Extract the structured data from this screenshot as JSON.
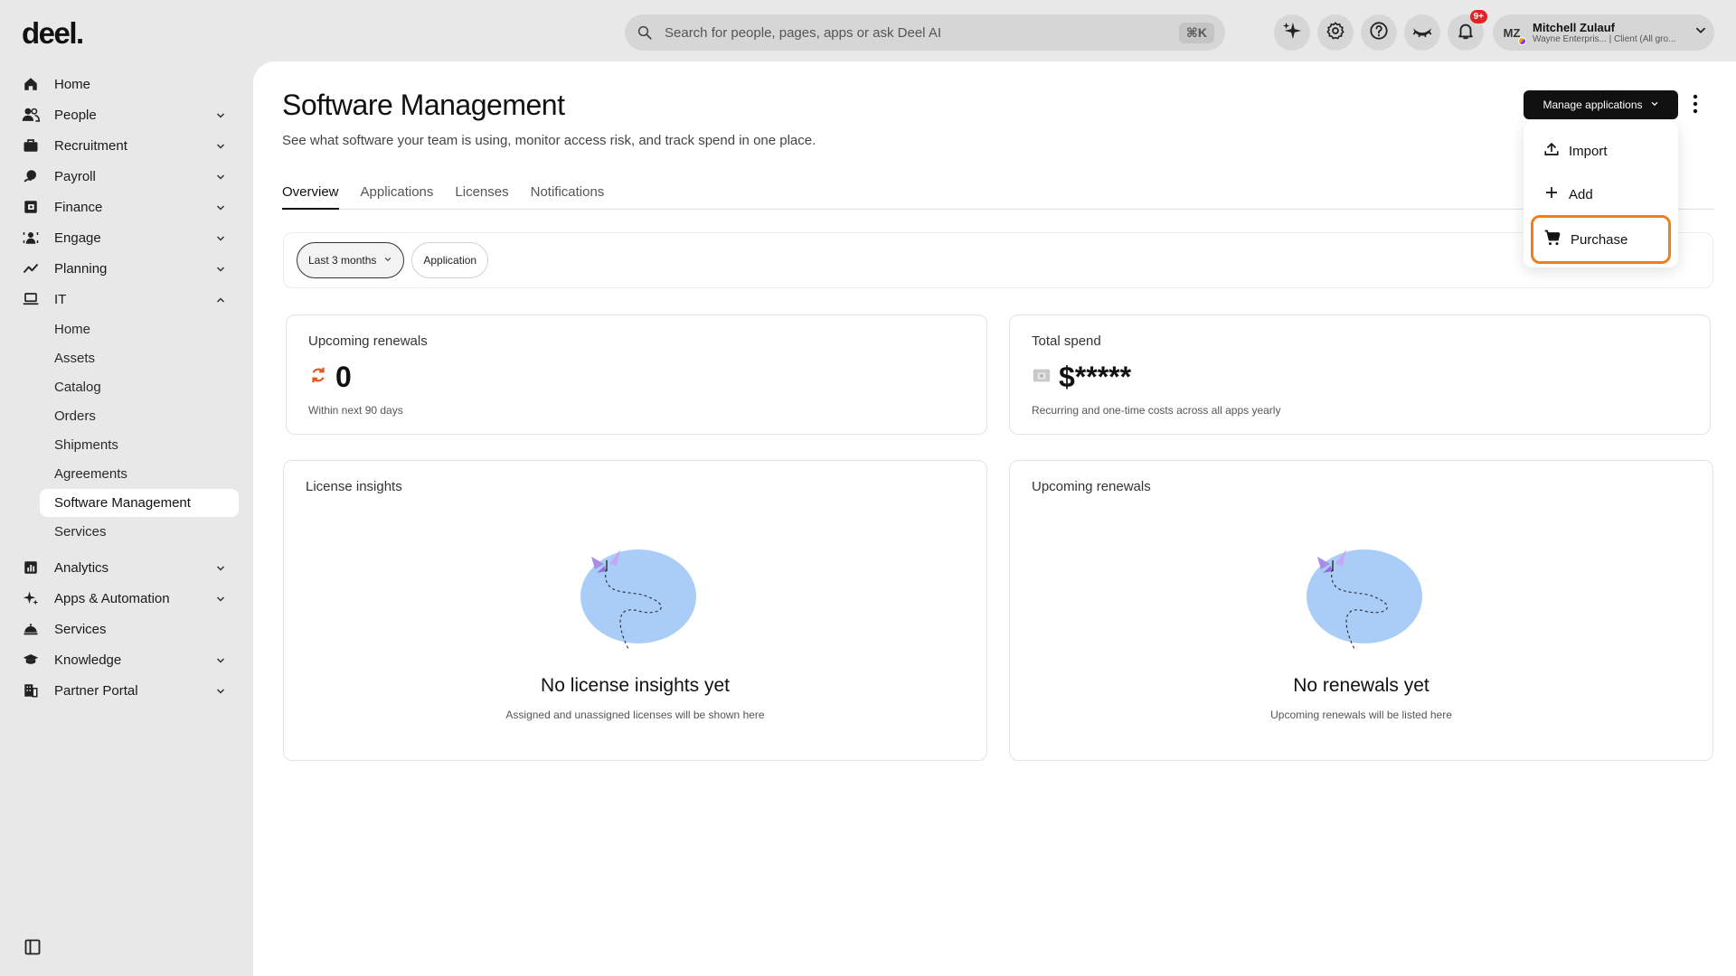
{
  "app": {
    "logo": "deel."
  },
  "search": {
    "placeholder": "Search for people, pages, apps or ask Deel AI",
    "shortcut": "⌘K"
  },
  "topbar": {
    "icons": [
      "sparkle-icon",
      "gear-icon",
      "help-icon",
      "eye-closed-icon",
      "bell-icon"
    ],
    "notification_badge": "9+",
    "user": {
      "initials": "MZ",
      "name": "Mitchell Zulauf",
      "subtitle": "Wayne Enterpris... | Client (All gro..."
    }
  },
  "sidebar": {
    "items": [
      {
        "label": "Home",
        "icon": "home-icon",
        "expandable": false
      },
      {
        "label": "People",
        "icon": "people-icon",
        "expandable": true
      },
      {
        "label": "Recruitment",
        "icon": "briefcase-icon",
        "expandable": true
      },
      {
        "label": "Payroll",
        "icon": "payroll-icon",
        "expandable": true
      },
      {
        "label": "Finance",
        "icon": "finance-icon",
        "expandable": true
      },
      {
        "label": "Engage",
        "icon": "engage-icon",
        "expandable": true
      },
      {
        "label": "Planning",
        "icon": "chart-line-icon",
        "expandable": true
      },
      {
        "label": "IT",
        "icon": "laptop-icon",
        "expandable": true,
        "expanded": true
      }
    ],
    "it_subitems": [
      "Home",
      "Assets",
      "Catalog",
      "Orders",
      "Shipments",
      "Agreements",
      "Software Management",
      "Services"
    ],
    "active_subitem": "Software Management",
    "items_after": [
      {
        "label": "Analytics",
        "icon": "analytics-icon",
        "expandable": true
      },
      {
        "label": "Apps & Automation",
        "icon": "automation-icon",
        "expandable": true
      },
      {
        "label": "Services",
        "icon": "services-icon",
        "expandable": false
      },
      {
        "label": "Knowledge",
        "icon": "graduation-cap-icon",
        "expandable": true
      },
      {
        "label": "Partner Portal",
        "icon": "building-icon",
        "expandable": true
      }
    ]
  },
  "page": {
    "title": "Software Management",
    "subtitle": "See what software your team is using, monitor access risk, and track spend in one place.",
    "tabs": [
      "Overview",
      "Applications",
      "Licenses",
      "Notifications"
    ],
    "active_tab": "Overview"
  },
  "filters": {
    "period": "Last 3 months",
    "application": "Application"
  },
  "cards": {
    "renewals": {
      "label": "Upcoming renewals",
      "value": "0",
      "footnote": "Within next 90 days"
    },
    "spend": {
      "label": "Total spend",
      "value": "$*****",
      "footnote": "Recurring and one-time costs across all apps yearly"
    },
    "license_insights": {
      "label": "License insights",
      "empty_title": "No license insights yet",
      "empty_sub": "Assigned and unassigned licenses will be shown here"
    },
    "upcoming_renewals": {
      "label": "Upcoming renewals",
      "empty_title": "No renewals yet",
      "empty_sub": "Upcoming renewals will be listed here"
    }
  },
  "manage": {
    "button_label": "Manage applications",
    "menu": [
      {
        "label": "Import",
        "icon": "upload-icon"
      },
      {
        "label": "Add",
        "icon": "plus-icon"
      },
      {
        "label": "Purchase",
        "icon": "cart-icon",
        "highlighted": true
      }
    ]
  },
  "colors": {
    "accent": "#111111",
    "highlight": "#f07f1a",
    "renewal_icon": "#e8541a",
    "illustration": "#a9cdf7"
  }
}
